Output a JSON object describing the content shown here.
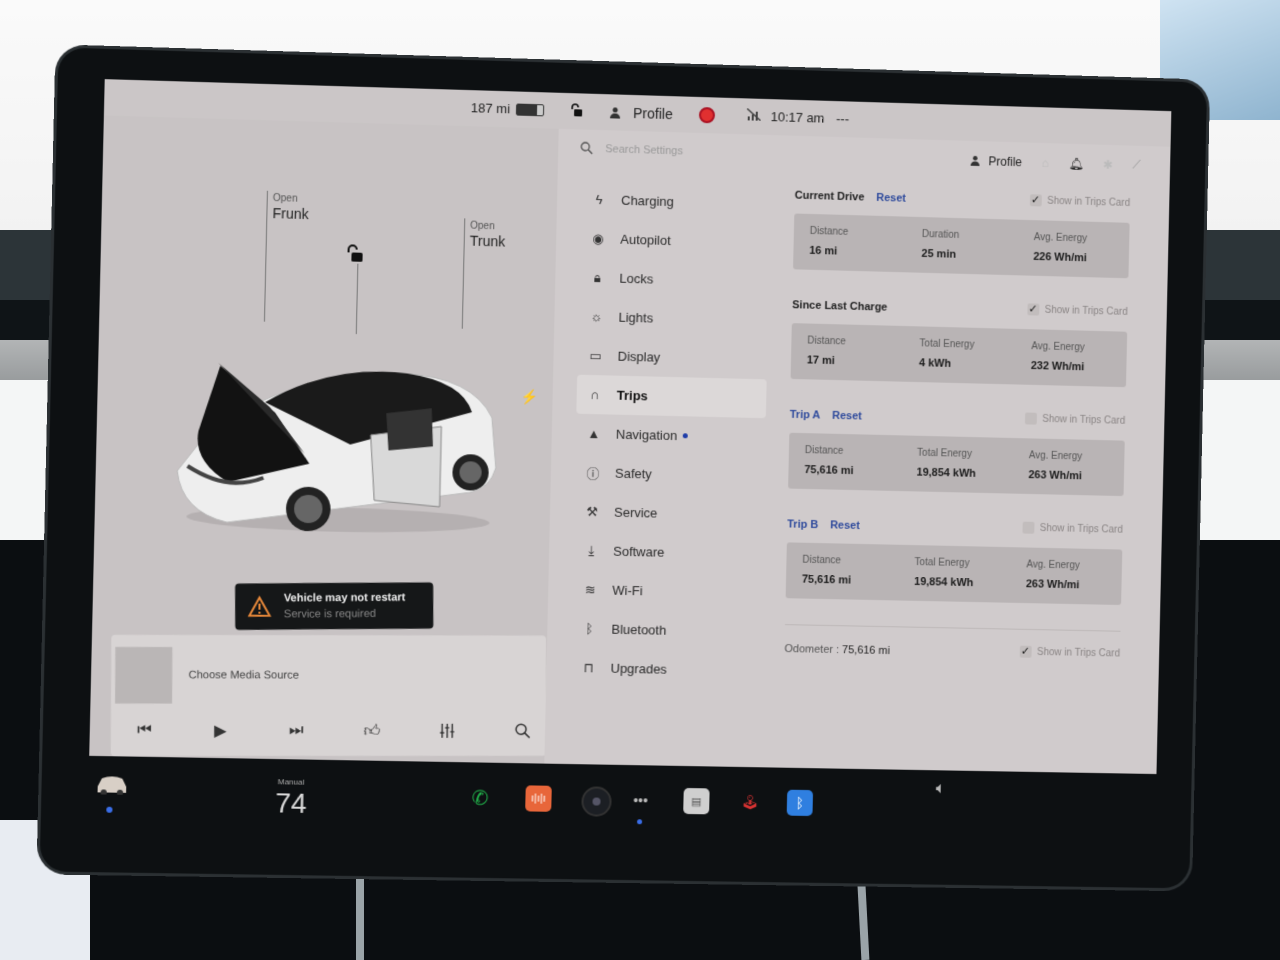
{
  "status_bar": {
    "range": "187 mi",
    "battery_level": 0.75,
    "profile_label": "Profile",
    "time": "10:17 am",
    "extra": "---"
  },
  "car_pane": {
    "frunk": {
      "action": "Open",
      "label": "Frunk"
    },
    "trunk": {
      "action": "Open",
      "label": "Trunk"
    },
    "alert": {
      "title": "Vehicle may not restart",
      "subtitle": "Service is required"
    },
    "media": {
      "source_label": "Choose Media Source",
      "controls": [
        "previous-track",
        "play",
        "next-track",
        "thumbs-up",
        "equalizer",
        "search"
      ]
    }
  },
  "settings": {
    "search_placeholder": "Search Settings",
    "profile_label": "Profile",
    "nav": [
      {
        "label": "Charging",
        "icon": "lightning-icon"
      },
      {
        "label": "Autopilot",
        "icon": "steering-wheel-icon"
      },
      {
        "label": "Locks",
        "icon": "lock-icon"
      },
      {
        "label": "Lights",
        "icon": "light-bulb-icon"
      },
      {
        "label": "Display",
        "icon": "display-icon"
      },
      {
        "label": "Trips",
        "icon": "trips-icon",
        "active": true
      },
      {
        "label": "Navigation",
        "icon": "navigation-icon",
        "badge": true
      },
      {
        "label": "Safety",
        "icon": "safety-icon"
      },
      {
        "label": "Service",
        "icon": "wrench-icon"
      },
      {
        "label": "Software",
        "icon": "download-icon"
      },
      {
        "label": "Wi-Fi",
        "icon": "wifi-icon"
      },
      {
        "label": "Bluetooth",
        "icon": "bluetooth-icon"
      },
      {
        "label": "Upgrades",
        "icon": "shopping-bag-icon"
      }
    ],
    "trips": {
      "show_in_trips_card_label": "Show in Trips Card",
      "reset_label": "Reset",
      "current_drive": {
        "title": "Current Drive",
        "show_in_card": true,
        "stats": [
          {
            "label": "Distance",
            "value": "16 mi"
          },
          {
            "label": "Duration",
            "value": "25 min"
          },
          {
            "label": "Avg. Energy",
            "value": "226 Wh/mi"
          }
        ]
      },
      "since_last_charge": {
        "title": "Since Last Charge",
        "show_in_card": true,
        "stats": [
          {
            "label": "Distance",
            "value": "17 mi"
          },
          {
            "label": "Total Energy",
            "value": "4 kWh"
          },
          {
            "label": "Avg. Energy",
            "value": "232 Wh/mi"
          }
        ]
      },
      "trip_a": {
        "title": "Trip A",
        "show_in_card": false,
        "stats": [
          {
            "label": "Distance",
            "value": "75,616 mi"
          },
          {
            "label": "Total Energy",
            "value": "19,854 kWh"
          },
          {
            "label": "Avg. Energy",
            "value": "263 Wh/mi"
          }
        ]
      },
      "trip_b": {
        "title": "Trip B",
        "show_in_card": false,
        "stats": [
          {
            "label": "Distance",
            "value": "75,616 mi"
          },
          {
            "label": "Total Energy",
            "value": "19,854 kWh"
          },
          {
            "label": "Avg. Energy",
            "value": "263 Wh/mi"
          }
        ]
      },
      "odometer": {
        "label": "Odometer :",
        "value": "75,616 mi",
        "show_in_card": true
      }
    }
  },
  "dock": {
    "climate_mode": "Manual",
    "temperature": "74",
    "apps": [
      "phone",
      "voice",
      "camera",
      "more",
      "notes",
      "toybox",
      "bluetooth"
    ]
  },
  "colors": {
    "accent_blue": "#2e4a9c",
    "record_red": "#e03030",
    "phone_green": "#21b04a",
    "voice_orange": "#e8663a",
    "bluetooth_blue": "#2f7fe0"
  }
}
